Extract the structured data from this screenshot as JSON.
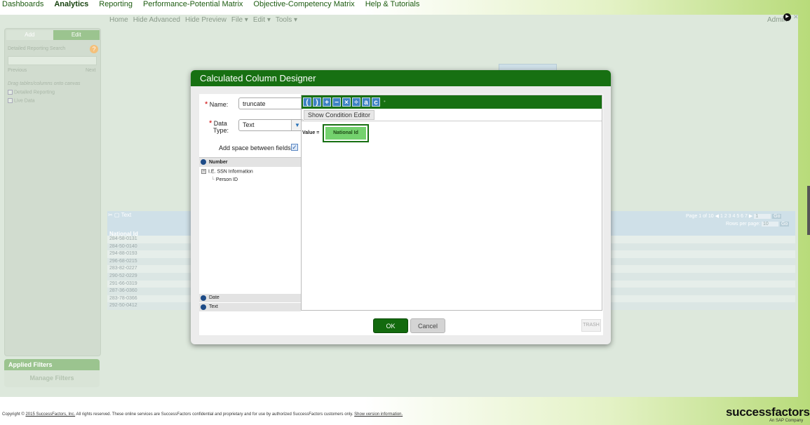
{
  "topnav": [
    "Dashboards",
    "Analytics",
    "Reporting",
    "Performance-Potential Matrix",
    "Objective-Competency Matrix",
    "Help & Tutorials"
  ],
  "active_nav": "Analytics",
  "toolbar": [
    "Home",
    "Hide Advanced",
    "Hide Preview",
    "File ▾",
    "Edit ▾",
    "Tools ▾"
  ],
  "admin_label": "Admin",
  "left_panel": {
    "tab_add": "Add",
    "tab_edit": "Edit",
    "search_label": "Detailed Reporting Search",
    "previous": "Previous",
    "next": "Next",
    "hint": "Drag tables/columns onto canvas",
    "opt_detailed": "Detailed Reporting",
    "opt_live": "Live Data"
  },
  "filters": {
    "title": "Applied Filters",
    "manage": "Manage Filters"
  },
  "bg_table": {
    "tab_label": "Text",
    "column": "National Id",
    "pager": "Page 1 of 10",
    "pages": "1 2 3 4 5 6 7",
    "go": "Go",
    "rows_per_page_label": "Rows per page:",
    "rows_per_page": "10",
    "page_input": "1",
    "rows": [
      "284-58-0131",
      "284-50-0140",
      "294-88-0193",
      "296-68-0215",
      "283-82-0227",
      "290-52-0229",
      "291-66-0319",
      "287-36-0360",
      "283-78-0366",
      "292-50-0412"
    ]
  },
  "modal": {
    "title": "Calculated Column Designer",
    "name_label": "Name:",
    "name_value": "truncate",
    "dtype_label_1": "Data",
    "dtype_label_2": "Type:",
    "dtype_value": "Text",
    "space_label": "Add space between fields",
    "tree": {
      "number_head": "Number",
      "group": "I.E. SSN Information",
      "child": "Person ID",
      "date_head": "Date",
      "text_head": "Text"
    },
    "operators": [
      "(",
      ")",
      "+",
      "−",
      "×",
      "÷",
      "a",
      "c"
    ],
    "condition_button": "Show Condition Editor",
    "value_label": "Value =",
    "value_token": "National Id",
    "ok": "OK",
    "cancel": "Cancel",
    "trash": "TRASH"
  },
  "footer": {
    "copyright_start": "Copyright © ",
    "copyright_link": "2015 SuccessFactors, Inc.",
    "copyright_rest": " All rights reserved. These online services are SuccessFactors confidential and proprietary and for use by authorized SuccessFactors customers only.",
    "version_link": "Show version information.",
    "brand": "successfactors",
    "brand_sub": "An SAP Company"
  },
  "colors": {
    "brand_green": "#177012",
    "token_green": "#74d26e",
    "operator_blue": "#3f83c4"
  }
}
